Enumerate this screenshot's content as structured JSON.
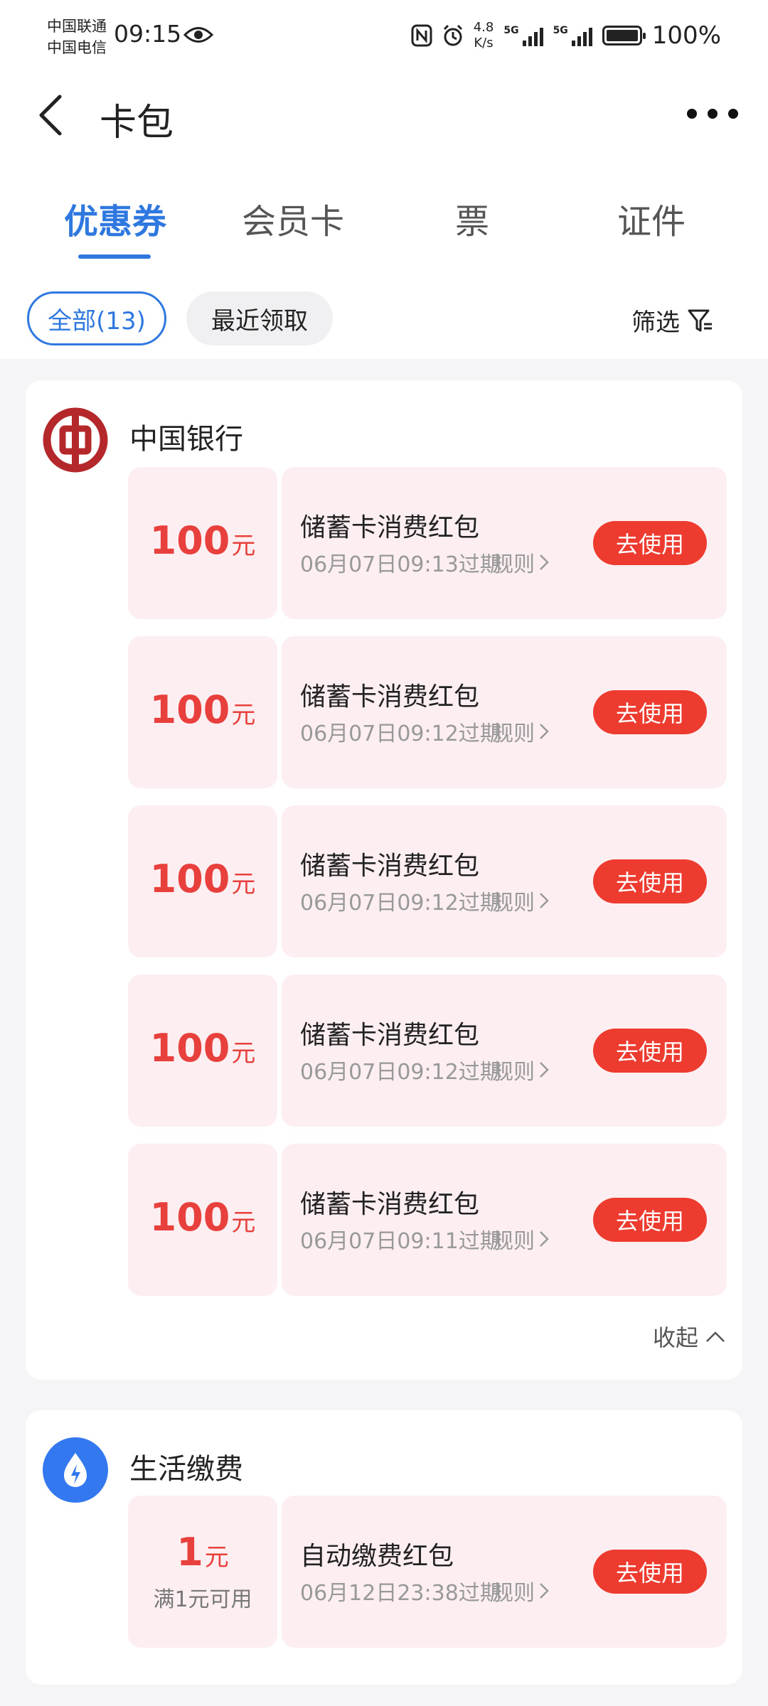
{
  "status_bar": {
    "carrier_1": "中国联通",
    "carrier_2": "中国电信",
    "time": "09:15",
    "speed_value": "4.8",
    "speed_unit": "K/s",
    "signal_1_label": "5G",
    "signal_2_label": "5G",
    "battery": "100%",
    "battery_level": 1.0,
    "icons": [
      "eye-icon",
      "nfc-icon",
      "alarm-icon",
      "signal-icon",
      "battery-icon"
    ]
  },
  "header": {
    "title": "卡包",
    "back_icon": "chevron-left-icon",
    "more_icon": "more-dots-icon"
  },
  "tabs": [
    {
      "label": "优惠券",
      "active": true
    },
    {
      "label": "会员卡",
      "active": false
    },
    {
      "label": "票",
      "active": false
    },
    {
      "label": "证件",
      "active": false
    }
  ],
  "filters": {
    "all_label": "全部(13)",
    "recent_label": "最近领取",
    "filter_label": "筛选",
    "filter_icon": "funnel-icon"
  },
  "groups": [
    {
      "name": "中国银行",
      "logo_icon": "bank-of-china-logo",
      "coupons": [
        {
          "amount": "100",
          "unit": "元",
          "name": "储蓄卡消费红包",
          "expiry": "06月07日09:13过期",
          "rule": "规则",
          "action": "去使用"
        },
        {
          "amount": "100",
          "unit": "元",
          "name": "储蓄卡消费红包",
          "expiry": "06月07日09:12过期",
          "rule": "规则",
          "action": "去使用"
        },
        {
          "amount": "100",
          "unit": "元",
          "name": "储蓄卡消费红包",
          "expiry": "06月07日09:12过期",
          "rule": "规则",
          "action": "去使用"
        },
        {
          "amount": "100",
          "unit": "元",
          "name": "储蓄卡消费红包",
          "expiry": "06月07日09:12过期",
          "rule": "规则",
          "action": "去使用"
        },
        {
          "amount": "100",
          "unit": "元",
          "name": "储蓄卡消费红包",
          "expiry": "06月07日09:11过期",
          "rule": "规则",
          "action": "去使用"
        }
      ],
      "collapse_label": "收起"
    },
    {
      "name": "生活缴费",
      "logo_icon": "lightning-drop-icon",
      "coupons": [
        {
          "amount": "1",
          "unit": "元",
          "condition": "满1元可用",
          "name": "自动缴费红包",
          "expiry": "06月12日23:38过期",
          "rule": "规则",
          "action": "去使用"
        }
      ]
    }
  ],
  "colors": {
    "accent_blue": "#2f78e0",
    "coupon_red": "#e8413d",
    "button_red": "#ed3b30",
    "coupon_bg": "#fdeff1",
    "bank_red": "#b4282c"
  }
}
